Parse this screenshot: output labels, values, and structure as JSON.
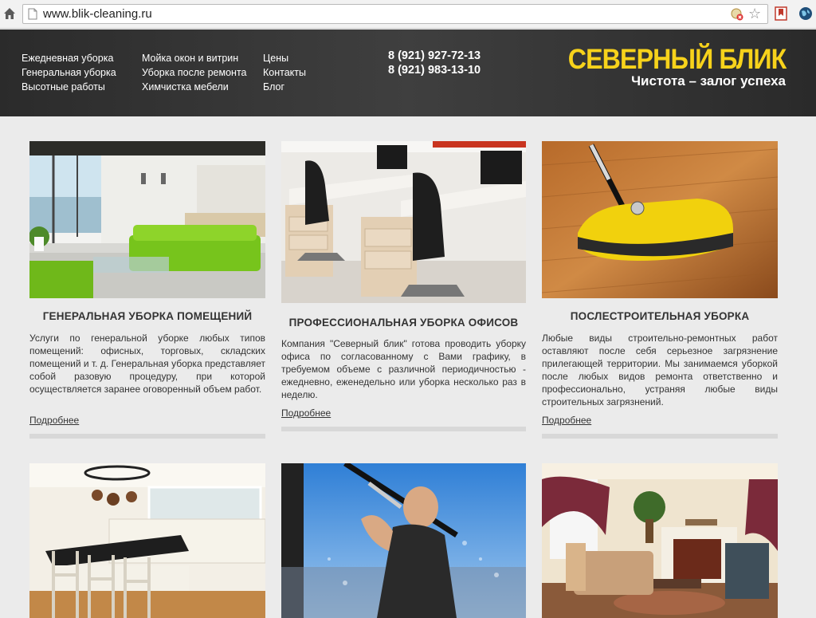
{
  "browser": {
    "url": "www.blik-cleaning.ru"
  },
  "nav": {
    "col1": [
      "Ежедневная уборка",
      "Генеральная уборка",
      "Высотные работы"
    ],
    "col2": [
      "Мойка окон и витрин",
      "Уборка после ремонта",
      "Химчистка мебели"
    ],
    "col3": [
      "Цены",
      "Контакты",
      "Блог"
    ]
  },
  "phones": [
    "8 (921) 927-72-13",
    "8 (921) 983-13-10"
  ],
  "brand": {
    "title": "СЕВЕРНЫЙ БЛИК",
    "slogan": "Чистота – залог успеха",
    "title_color": "#f7d21b"
  },
  "cards": [
    {
      "title": "ГЕНЕРАЛЬНАЯ УБОРКА ПОМЕЩЕНИЙ",
      "text": "Услуги по генеральной уборке любых типов помещений: офисных, торговых, складских помещений и т. д. Генеральная уборка представляет собой разовую процедуру, при которой осуществляется заранее оговоренный объем работ.",
      "more": "Подробнее",
      "image": "living-room-green-sofa"
    },
    {
      "title": "ПРОФЕССИОНАЛЬНАЯ УБОРКА ОФИСОВ",
      "text": "Компания \"Северный блик\" готова проводить уборку офиса по согласованному с Вами графику, в требуемом объеме с различной периодичностью - ежедневно, еженедельно или уборка несколько раз в неделю.",
      "more": "Подробнее",
      "image": "office-desks"
    },
    {
      "title": "ПОСЛЕСТРОИТЕЛЬНАЯ УБОРКА",
      "text": "Любые виды строительно-ремонтных работ оставляют после себя серьезное загрязнение прилегающей территории. Мы занимаемся уборкой после любых видов ремонта ответственно и профессионально, устраняя любые виды строительных загрязнений.",
      "more": "Подробнее",
      "image": "yellow-floor-sweeper"
    },
    {
      "image": "kitchen"
    },
    {
      "image": "window-washing"
    },
    {
      "image": "living-room-fireplace"
    }
  ]
}
